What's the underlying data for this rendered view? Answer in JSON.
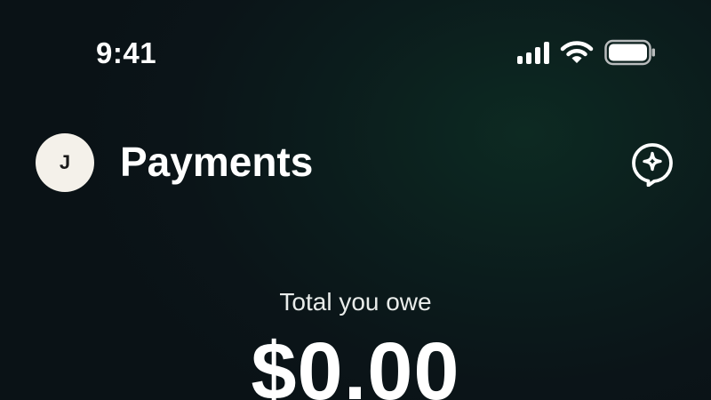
{
  "status_bar": {
    "time": "9:41",
    "icons": [
      "cellular-signal-icon",
      "wifi-icon",
      "battery-icon"
    ]
  },
  "header": {
    "avatar_initial": "J",
    "title": "Payments",
    "assistant_icon": "sparkle-chat-icon"
  },
  "balance": {
    "label": "Total you owe",
    "amount": "$0.00"
  },
  "colors": {
    "background": "#0b1418",
    "background_glow": "#0d2a22",
    "text": "#ffffff",
    "avatar_bg": "#f4f1ea"
  }
}
